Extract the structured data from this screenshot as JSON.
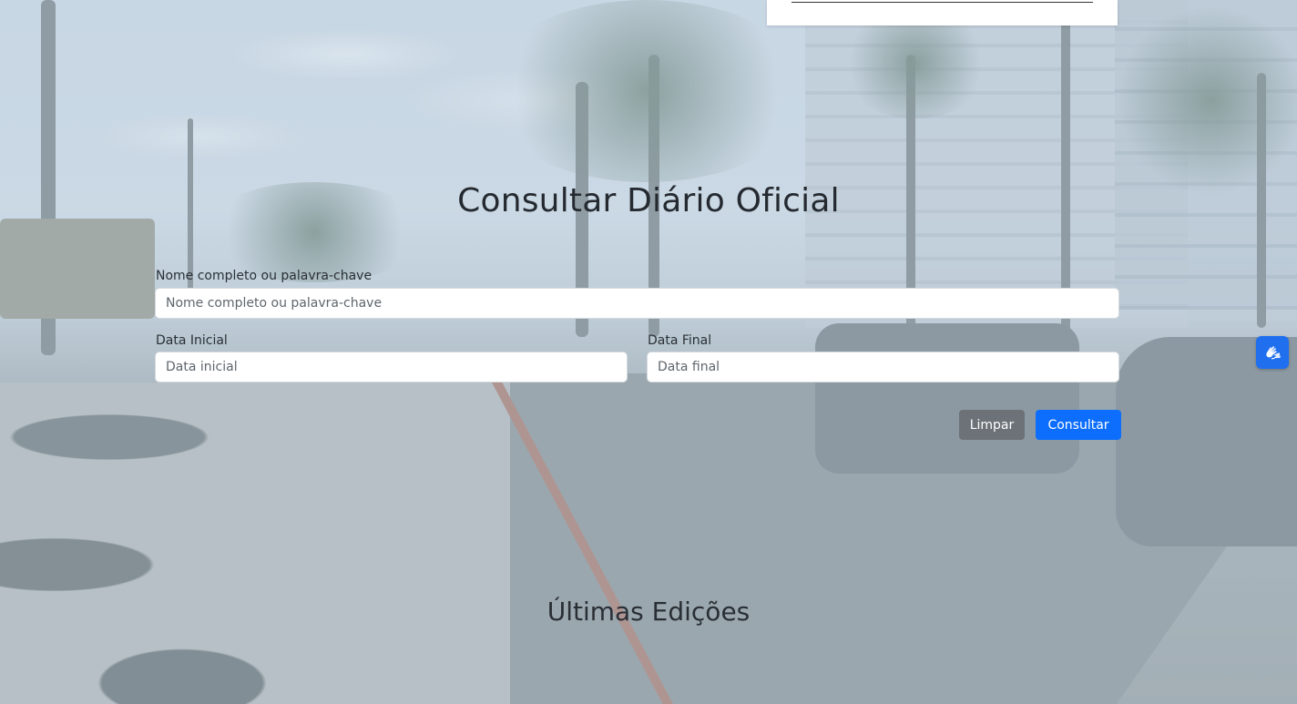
{
  "search": {
    "title": "Consultar Diário Oficial",
    "keyword": {
      "label": "Nome completo ou palavra-chave",
      "placeholder": "Nome completo ou palavra-chave",
      "value": ""
    },
    "date_start": {
      "label": "Data Inicial",
      "placeholder": "Data inicial",
      "value": ""
    },
    "date_end": {
      "label": "Data Final",
      "placeholder": "Data final",
      "value": ""
    },
    "clear_label": "Limpar",
    "submit_label": "Consultar"
  },
  "latest": {
    "title": "Últimas Edições"
  },
  "accessibility": {
    "icon": "sign-language-icon"
  },
  "colors": {
    "primary": "#0d6efd",
    "secondary": "#6c7278",
    "a11y": "#1f6fef"
  }
}
